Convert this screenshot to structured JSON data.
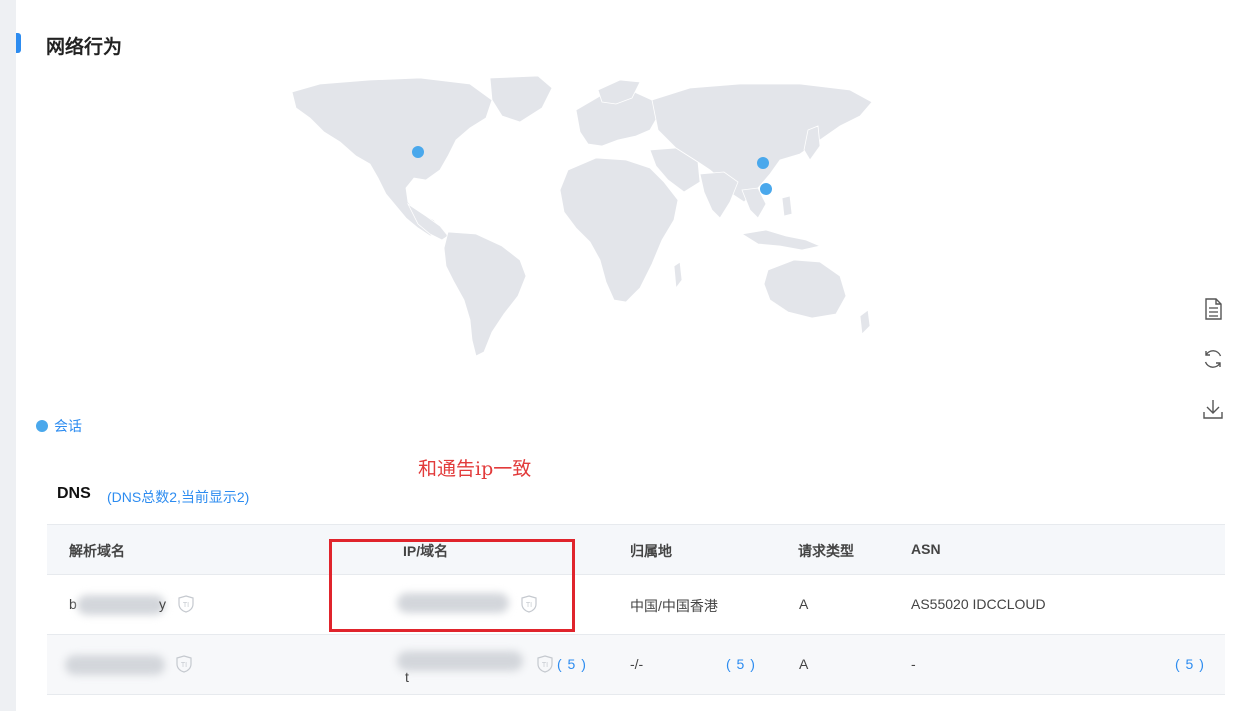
{
  "section": {
    "title": "网络行为"
  },
  "map": {
    "land_color": "#e3e5ea",
    "marker_color": "#4aa8ec",
    "markers": [
      {
        "name": "usa"
      },
      {
        "name": "china-north"
      },
      {
        "name": "china-south"
      }
    ]
  },
  "side_tools": [
    "document-icon",
    "refresh-icon",
    "download-icon"
  ],
  "legend": {
    "label": "会话"
  },
  "annotation": {
    "text": "和通告ip一致"
  },
  "dns": {
    "title": "DNS",
    "summary": "(DNS总数2,当前显示2)",
    "columns": [
      "解析域名",
      "IP/域名",
      "归属地",
      "请求类型",
      "ASN"
    ],
    "rows": [
      {
        "domain_prefix": "b",
        "domain_suffix": "y",
        "ip_visible": "",
        "location": "中国/中国香港",
        "type": "A",
        "asn": "AS55020 IDCCLOUD"
      },
      {
        "domain_prefix": "",
        "domain_suffix": "",
        "ip_line2": "t",
        "ip_count": "( 5 )",
        "location": "-/-",
        "location_count": "( 5 )",
        "type": "A",
        "asn": "-",
        "asn_count": "( 5 )"
      }
    ]
  },
  "colors": {
    "accent": "#2d8cf0",
    "highlight": "#e0242c",
    "annotation": "#e23b3b"
  }
}
